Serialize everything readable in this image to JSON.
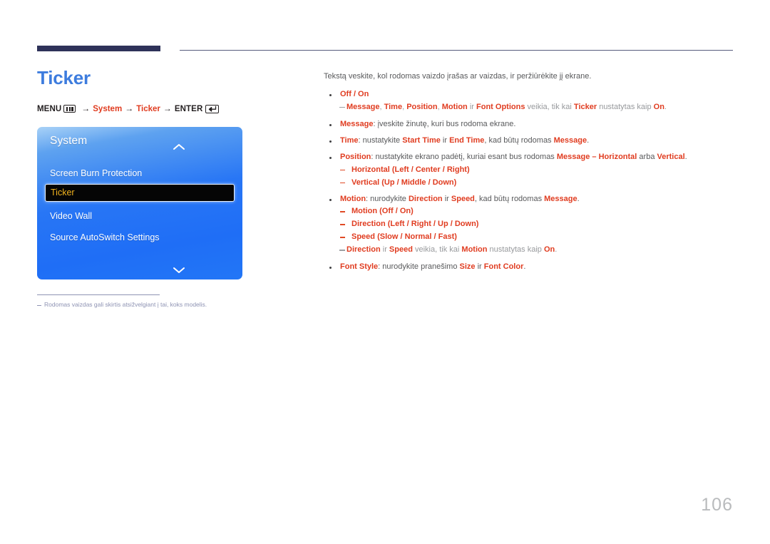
{
  "page": {
    "number": "106",
    "title": "Ticker"
  },
  "breadcrumb": {
    "menu_label": "MENU",
    "menu_icon": "menu-bars-icon",
    "arrow": "→",
    "step1": "System",
    "step2": "Ticker",
    "enter_label": "ENTER",
    "enter_icon": "enter-return-icon"
  },
  "osd": {
    "title": "System",
    "scroll_up_icon": "chevron-up-icon",
    "scroll_down_icon": "chevron-down-icon",
    "items": [
      {
        "label": "Screen Burn Protection",
        "selected": false
      },
      {
        "label": "Ticker",
        "selected": true
      },
      {
        "label": "Video Wall",
        "selected": false
      },
      {
        "label": "Source AutoSwitch Settings",
        "selected": false
      }
    ]
  },
  "footnote": {
    "text": "Rodomas vaizdas gali skirtis atsižvelgiant į tai, koks modelis."
  },
  "content": {
    "intro": "Tekstą veskite, kol rodomas vaizdo įrašas ar vaizdas, ir peržiūrėkite jį ekrane.",
    "b1": "Off / On",
    "b1_note_1": "Message",
    "b1_note_2": ", ",
    "b1_note_3": "Time",
    "b1_note_4": ", ",
    "b1_note_5": "Position",
    "b1_note_6": ", ",
    "b1_note_7": "Motion",
    "b1_note_8": " ir ",
    "b1_note_9": "Font Options",
    "b1_note_10": " veikia, tik kai ",
    "b1_note_11": "Ticker",
    "b1_note_12": " nustatytas kaip ",
    "b1_note_13": "On",
    "b1_note_14": ".",
    "b2_term": "Message",
    "b2_rest": ": įveskite žinutę, kuri bus rodoma ekrane.",
    "b3_term": "Time",
    "b3_a": ": nustatykite ",
    "b3_b": "Start Time",
    "b3_c": " ir ",
    "b3_d": "End Time",
    "b3_e": ", kad būtų rodomas ",
    "b3_f": "Message",
    "b3_g": ".",
    "b4_term": "Position",
    "b4_a": ": nustatykite ekrano padėtį, kuriai esant bus rodomas ",
    "b4_b": "Message – Horizontal",
    "b4_c": " arba ",
    "b4_d": "Vertical",
    "b4_e": ".",
    "b4_s1_term": "Horizontal",
    "b4_s1_a": " (",
    "b4_s1_b": "Left / Center / Right",
    "b4_s1_c": ")",
    "b4_s2_term": "Vertical",
    "b4_s2_a": " (",
    "b4_s2_b": "Up / Middle / Down",
    "b4_s2_c": ")",
    "b5_term": "Motion",
    "b5_a": ": nurodykite ",
    "b5_b": "Direction",
    "b5_c": " ir ",
    "b5_d": "Speed",
    "b5_e": ", kad būtų rodomas ",
    "b5_f": "Message",
    "b5_g": ".",
    "b5_s1_term": "Motion",
    "b5_s1_a": " (",
    "b5_s1_b": "Off / On",
    "b5_s1_c": ")",
    "b5_s2_term": "Direction",
    "b5_s2_a": " (",
    "b5_s2_b": "Left / Right / Up / Down",
    "b5_s2_c": ")",
    "b5_s3_term": "Speed",
    "b5_s3_a": " (",
    "b5_s3_b": "Slow / Normal / Fast",
    "b5_s3_c": ")",
    "b5_note_1": "Direction",
    "b5_note_2": " ir ",
    "b5_note_3": "Speed",
    "b5_note_4": " veikia, tik kai ",
    "b5_note_5": "Motion",
    "b5_note_6": " nustatytas kaip ",
    "b5_note_7": "On",
    "b5_note_8": ".",
    "b6_term": "Font Style",
    "b6_a": ": nurodykite pranešimo ",
    "b6_b": "Size",
    "b6_c": " ir ",
    "b6_d": "Font Color",
    "b6_e": "."
  },
  "colors": {
    "heading": "#3d7cde",
    "accent_red": "#e03c20",
    "rule_navy": "#2e3259",
    "osd_blue": "#2276f6",
    "osd_selected_text": "#f0b21e"
  }
}
